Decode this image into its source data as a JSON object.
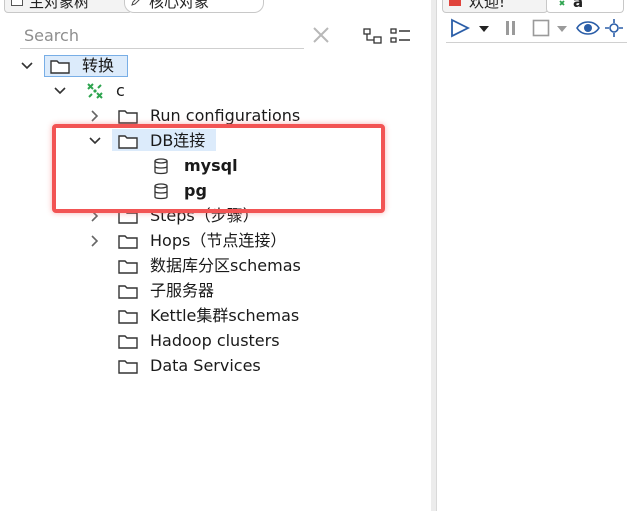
{
  "left_tabs": [
    {
      "label": "主对象树"
    },
    {
      "label": "核心对象"
    }
  ],
  "search": {
    "placeholder": "Search"
  },
  "tree": {
    "root": {
      "label": "转换"
    },
    "transform": {
      "label": "c"
    },
    "run_configs": {
      "label": "Run configurations"
    },
    "db_connections": {
      "label": "DB连接"
    },
    "db_items": [
      {
        "label": "mysql"
      },
      {
        "label": "pg"
      }
    ],
    "steps": {
      "label": "Steps（步骤）"
    },
    "hops": {
      "label": "Hops（节点连接）"
    },
    "partition_schemas": {
      "label": "数据库分区schemas"
    },
    "sub_servers": {
      "label": "子服务器"
    },
    "cluster_schemas": {
      "label": "Kettle集群schemas"
    },
    "hadoop_clusters": {
      "label": "Hadoop clusters"
    },
    "data_services": {
      "label": "Data Services"
    }
  },
  "right_tabs": [
    {
      "label": "欢迎!"
    },
    {
      "label": "a"
    }
  ],
  "colors": {
    "selection_bg": "#dcebfb",
    "selection_border": "#78aee6",
    "annotation_red": "#f25454",
    "transform_icon_green": "#2ea44f",
    "play_icon_blue": "#2b5ea8"
  }
}
